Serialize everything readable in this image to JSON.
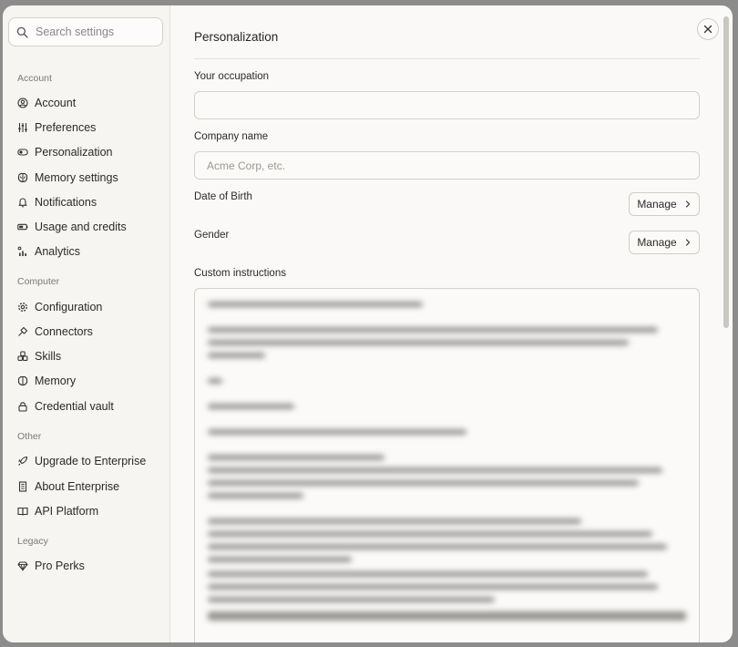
{
  "search": {
    "placeholder": "Search settings"
  },
  "sidebar": {
    "sections": [
      {
        "label": "Account",
        "items": [
          {
            "label": "Account",
            "icon": "user-circle-icon"
          },
          {
            "label": "Preferences",
            "icon": "sliders-icon"
          },
          {
            "label": "Personalization",
            "icon": "toggle-icon"
          },
          {
            "label": "Memory settings",
            "icon": "brain-icon"
          },
          {
            "label": "Notifications",
            "icon": "bell-icon"
          },
          {
            "label": "Usage and credits",
            "icon": "battery-icon"
          },
          {
            "label": "Analytics",
            "icon": "chart-icon"
          }
        ]
      },
      {
        "label": "Computer",
        "items": [
          {
            "label": "Configuration",
            "icon": "gear-icon"
          },
          {
            "label": "Connectors",
            "icon": "plug-icon"
          },
          {
            "label": "Skills",
            "icon": "blocks-icon"
          },
          {
            "label": "Memory",
            "icon": "brain-icon"
          },
          {
            "label": "Credential vault",
            "icon": "lock-icon"
          }
        ]
      },
      {
        "label": "Other",
        "items": [
          {
            "label": "Upgrade to Enterprise",
            "icon": "rocket-icon"
          },
          {
            "label": "About Enterprise",
            "icon": "building-icon"
          },
          {
            "label": "API Platform",
            "icon": "book-icon"
          }
        ]
      },
      {
        "label": "Legacy",
        "items": [
          {
            "label": "Pro Perks",
            "icon": "diamond-icon"
          }
        ]
      }
    ]
  },
  "main": {
    "title": "Personalization",
    "occupation": {
      "label": "Your occupation",
      "value": "",
      "placeholder": ""
    },
    "company": {
      "label": "Company name",
      "value": "",
      "placeholder": "Acme Corp, etc."
    },
    "dob": {
      "label": "Date of Birth",
      "button": "Manage"
    },
    "gender": {
      "label": "Gender",
      "button": "Manage"
    },
    "custom_instructions": {
      "label": "Custom instructions"
    }
  }
}
